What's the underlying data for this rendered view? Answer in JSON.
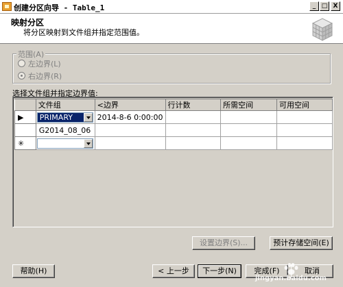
{
  "window": {
    "title": "创建分区向导 - Table_1",
    "min": "_",
    "max": "□",
    "close": "X"
  },
  "header": {
    "title": "映射分区",
    "subtitle": "将分区映射到文件组并指定范围值。"
  },
  "range_group": {
    "legend": "范围(A)",
    "options": [
      {
        "label": "左边界(L)",
        "selected": false,
        "enabled": false
      },
      {
        "label": "右边界(R)",
        "selected": true,
        "enabled": false
      }
    ]
  },
  "grid_caption": "选择文件组并指定边界值:",
  "grid": {
    "columns": [
      "文件组",
      "<边界",
      "行计数",
      "所需空间",
      "可用空间"
    ],
    "rows": [
      {
        "marker": "▶",
        "filegroup": "PRIMARY",
        "boundary": "2014-8-6 0:00:00",
        "row_count": "",
        "required": "",
        "available": ""
      },
      {
        "marker": "",
        "filegroup": "G2014_08_06",
        "boundary": "",
        "row_count": "",
        "required": "",
        "available": ""
      },
      {
        "marker": "✳",
        "filegroup": "",
        "boundary": "",
        "row_count": "",
        "required": "",
        "available": ""
      }
    ]
  },
  "buttons": {
    "set_boundaries": "设置边界(S)...",
    "estimate_storage": "预计存储空间(E)",
    "help": "帮助(H)",
    "back": "< 上一步",
    "next": "下一步(N)",
    "finish": "完成(F)",
    "cancel": "取消"
  },
  "watermark": {
    "brand": "Bai经验",
    "sub": "jingyan.baidu.com"
  }
}
